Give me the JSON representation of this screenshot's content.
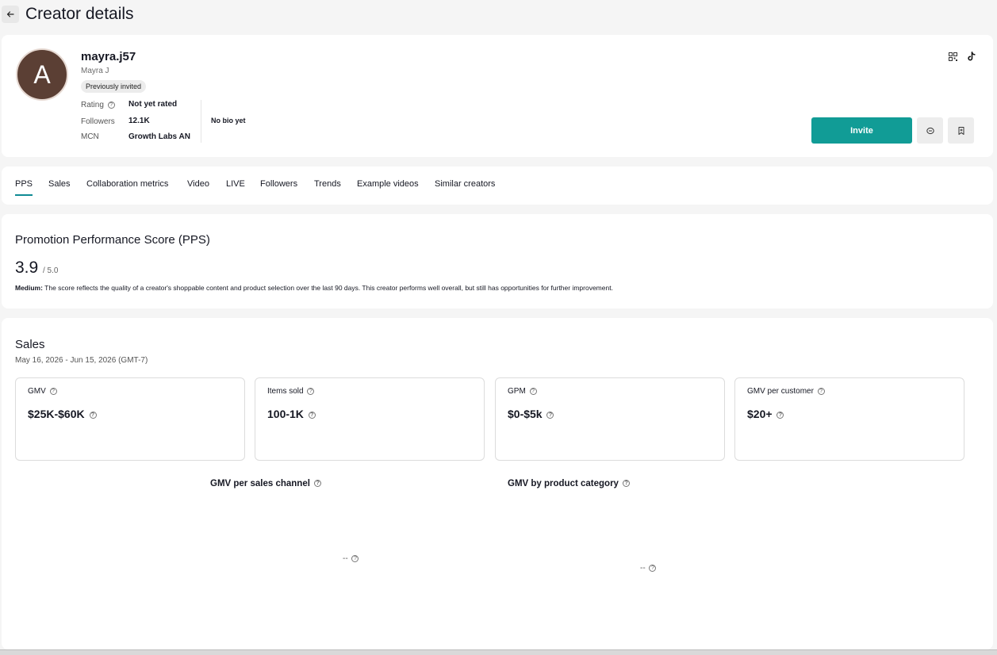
{
  "header": {
    "title": "Creator details"
  },
  "profile": {
    "avatar_letter": "A",
    "username": "mayra.j57",
    "display_name": "Mayra J",
    "badge": "Previously invited",
    "rating_label": "Rating",
    "rating_value": "Not yet rated",
    "followers_label": "Followers",
    "followers_value": "12.1K",
    "mcn_label": "MCN",
    "mcn_value": "Growth Labs AN",
    "bio": "No bio yet",
    "invite_label": "Invite"
  },
  "tabs": [
    {
      "label": "PPS"
    },
    {
      "label": "Sales"
    },
    {
      "label": "Collaboration metrics"
    },
    {
      "label": "Video"
    },
    {
      "label": "LIVE"
    },
    {
      "label": "Followers"
    },
    {
      "label": "Trends"
    },
    {
      "label": "Example videos"
    },
    {
      "label": "Similar creators"
    }
  ],
  "pps": {
    "title": "Promotion Performance Score (PPS)",
    "score": "3.9",
    "max": "/ 5.0",
    "level": "Medium:",
    "description": "The score reflects the quality of a creator's shoppable content and product selection over the last 90 days. This creator performs well overall, but still has opportunities for further improvement."
  },
  "sales": {
    "title": "Sales",
    "date_range": "May 16, 2026 - Jun 15, 2026 (GMT-7)",
    "metrics": [
      {
        "label": "GMV",
        "value": "$25K-$60K"
      },
      {
        "label": "Items sold",
        "value": "100-1K"
      },
      {
        "label": "GPM",
        "value": "$0-$5k"
      },
      {
        "label": "GMV per customer",
        "value": "$20+"
      }
    ],
    "chart_channel_title": "GMV per sales channel",
    "chart_category_title": "GMV by product category",
    "chart_channel_empty": "--",
    "chart_category_empty": "--"
  },
  "colors": {
    "accent": "#119c96",
    "tab_underline": "#0f8b94",
    "avatar_bg": "#5b3f34"
  },
  "icons": [
    "back-arrow-icon",
    "qr-code-icon",
    "tiktok-icon",
    "message-icon",
    "bookmark-icon",
    "help-icon"
  ]
}
